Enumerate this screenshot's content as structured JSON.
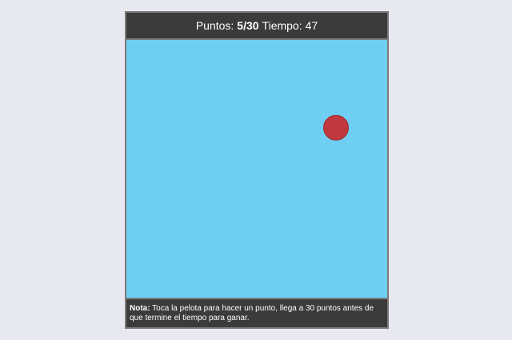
{
  "header": {
    "points_label": "Puntos:",
    "points_value": "5/30",
    "time_label": "Tiempo:",
    "time_value": "47"
  },
  "game": {
    "background_color": "#6fcff2",
    "ball_color": "#c0393e"
  },
  "note": {
    "label": "Nota:",
    "text": "Toca la pelota para hacer un punto, llega a 30 puntos antes de que termine el tiempo para ganar."
  }
}
